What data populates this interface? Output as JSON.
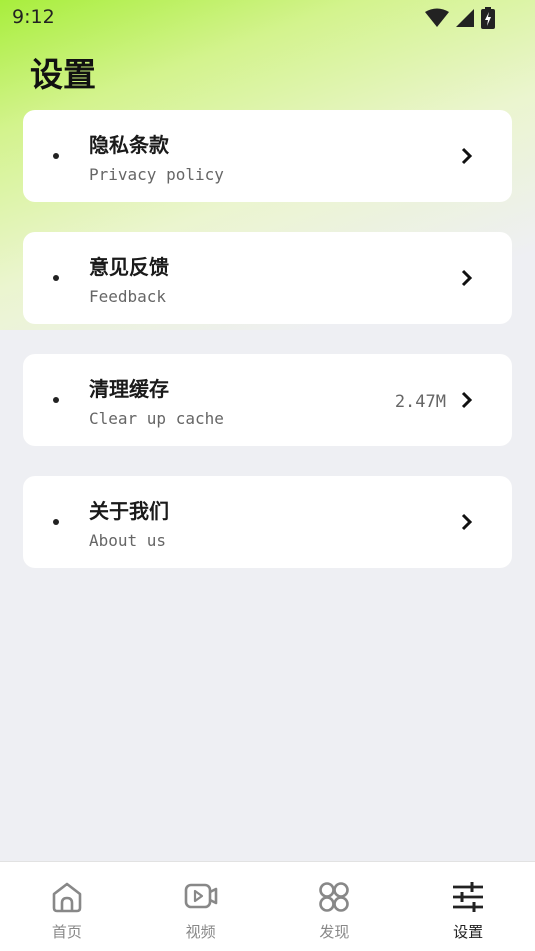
{
  "status_bar": {
    "time": "9:12",
    "icons": [
      "wifi-icon",
      "cell-signal-icon",
      "battery-charging-icon"
    ]
  },
  "page": {
    "title": "设置",
    "accent_gradient": [
      "#a8ee3c",
      "#eeeff3"
    ]
  },
  "menu": {
    "items": [
      {
        "title": "隐私条款",
        "subtitle": "Privacy policy",
        "value": ""
      },
      {
        "title": "意见反馈",
        "subtitle": "Feedback",
        "value": ""
      },
      {
        "title": "清理缓存",
        "subtitle": "Clear up cache",
        "value": "2.47M"
      },
      {
        "title": "关于我们",
        "subtitle": "About us",
        "value": ""
      }
    ]
  },
  "tab_bar": {
    "tabs": [
      {
        "label": "首页",
        "icon": "home-icon",
        "active": false
      },
      {
        "label": "视频",
        "icon": "video-icon",
        "active": false
      },
      {
        "label": "发现",
        "icon": "discover-icon",
        "active": false
      },
      {
        "label": "设置",
        "icon": "settings-sliders-icon",
        "active": true
      }
    ],
    "active_color": "#222222",
    "inactive_color": "#888888"
  }
}
